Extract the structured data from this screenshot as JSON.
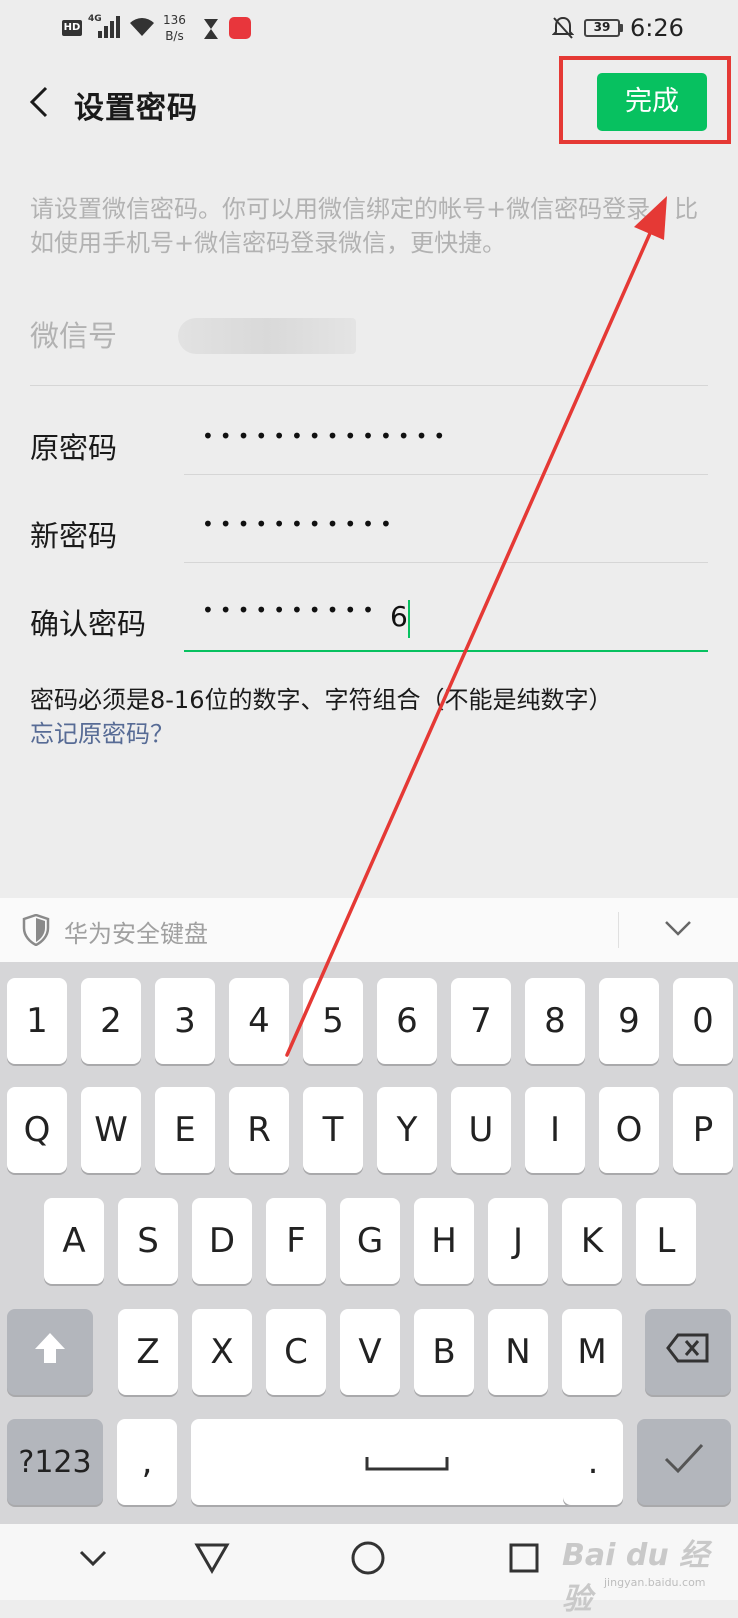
{
  "status_bar": {
    "hd": "HD",
    "network": "4G",
    "speed_value": "136",
    "speed_unit": "B/s",
    "battery": "39",
    "time": "6:26"
  },
  "header": {
    "title": "设置密码",
    "done_label": "完成"
  },
  "description": "请设置微信密码。你可以用微信绑定的帐号+微信密码登录，比如使用手机号+微信密码登录微信，更快捷。",
  "form": {
    "wechat_id_label": "微信号",
    "old_password_label": "原密码",
    "old_password_value": "••••••••••••••",
    "new_password_label": "新密码",
    "new_password_value": "•••••••••••",
    "confirm_password_label": "确认密码",
    "confirm_password_value": "••••••••••",
    "confirm_password_last_char": "6",
    "hint": "密码必须是8-16位的数字、字符组合（不能是纯数字）",
    "forgot_link": "忘记原密码？"
  },
  "keyboard": {
    "brand": "华为安全键盘",
    "row_digits": [
      "1",
      "2",
      "3",
      "4",
      "5",
      "6",
      "7",
      "8",
      "9",
      "0"
    ],
    "row_q": [
      "Q",
      "W",
      "E",
      "R",
      "T",
      "Y",
      "U",
      "I",
      "O",
      "P"
    ],
    "row_a": [
      "A",
      "S",
      "D",
      "F",
      "G",
      "H",
      "J",
      "K",
      "L"
    ],
    "row_z": [
      "Z",
      "X",
      "C",
      "V",
      "B",
      "N",
      "M"
    ],
    "symbol_key": "?123",
    "comma_key": ",",
    "period_key": "."
  },
  "watermark": {
    "logo": "Bai du 经验",
    "url": "jingyan.baidu.com"
  },
  "colors": {
    "accent_green": "#07c160",
    "link_blue": "#576b95",
    "annotation_red": "#e53935"
  }
}
